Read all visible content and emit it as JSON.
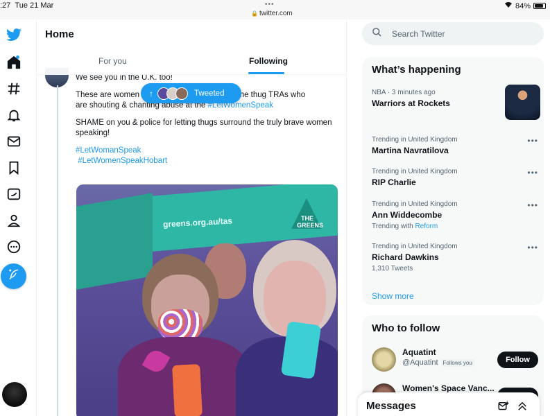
{
  "status": {
    "time": ":27",
    "date": "Tue 21 Mar",
    "dots": "•••",
    "url": "twitter.com",
    "battery": "84%"
  },
  "nav": {
    "icons": [
      "twitter-logo-icon",
      "home-icon",
      "explore-icon",
      "notifications-icon",
      "messages-icon",
      "bookmarks-icon",
      "twitter-blue-icon",
      "profile-icon",
      "more-icon"
    ],
    "compose": "compose-icon"
  },
  "main": {
    "title": "Home",
    "tabs": [
      {
        "label": "For you",
        "active": false
      },
      {
        "label": "Following",
        "active": true
      }
    ],
    "tweeted_pill": "Tweeted",
    "tweet": {
      "line1": "We see you in the U.K. too!",
      "line2a": "These are women F",
      "line2b": "g with the thug TRAs who",
      "line3": "are shouting & chanting abuse at the ",
      "tag_inline": "#LetWomenSpeak",
      "para2": "SHAME on you & police for letting thugs surround the truly brave women speaking!",
      "hashtag1": "#LetWomanSpeak",
      "hashtag2": "#LetWomenSpeakHobart"
    },
    "photo": {
      "banner_text": "greens.org.au/tas",
      "sign_text": "THE GREENS"
    }
  },
  "search": {
    "placeholder": "Search Twitter"
  },
  "happening": {
    "title": "What’s happening",
    "trends": [
      {
        "context": "NBA · 3 minutes ago",
        "name": "Warriors at Rockets",
        "sub": "",
        "sub_link": ""
      },
      {
        "context": "Trending in United Kingdom",
        "name": "Martina Navratilova",
        "sub": "",
        "sub_link": ""
      },
      {
        "context": "Trending in United Kingdom",
        "name": "RIP Charlie",
        "sub": "",
        "sub_link": ""
      },
      {
        "context": "Trending in United Kingdom",
        "name": "Ann Widdecombe",
        "sub": "Trending with ",
        "sub_link": "Reform"
      },
      {
        "context": "Trending in United Kingdom",
        "name": "Richard Dawkins",
        "sub": "1,310 Tweets",
        "sub_link": ""
      }
    ],
    "more_dots": "•••",
    "show_more": "Show more"
  },
  "who_to_follow": {
    "title": "Who to follow",
    "accounts": [
      {
        "name": "Aquatint",
        "handle": "@Aquatint",
        "badge": "Follows you",
        "button": "Follow"
      },
      {
        "name": "Women's Space Vanc...",
        "handle": "",
        "badge": "",
        "button": ""
      }
    ]
  },
  "messages": {
    "title": "Messages"
  },
  "colors": {
    "accent": "#1d9bf0",
    "text": "#0f1419",
    "muted": "#536471",
    "panel": "#f7f9f9"
  }
}
